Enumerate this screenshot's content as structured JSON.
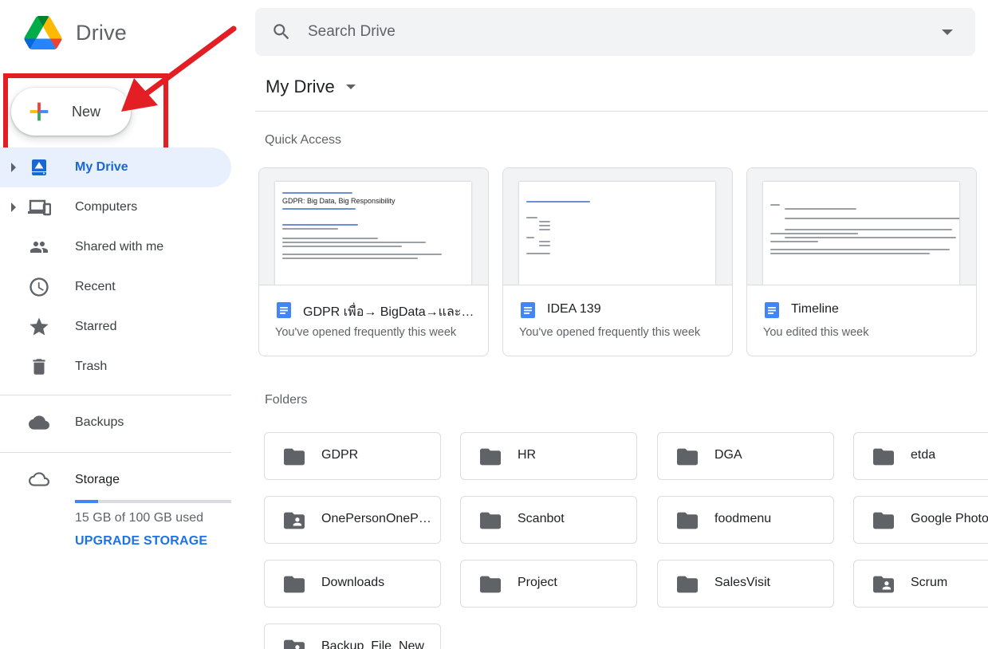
{
  "app": {
    "name": "Drive"
  },
  "sidebar": {
    "new_label": "New",
    "items": [
      {
        "label": "My Drive",
        "icon": "my-drive-icon",
        "active": true,
        "expandable": true
      },
      {
        "label": "Computers",
        "icon": "computers-icon",
        "active": false,
        "expandable": true
      },
      {
        "label": "Shared with me",
        "icon": "shared-with-me-icon",
        "active": false,
        "expandable": false
      },
      {
        "label": "Recent",
        "icon": "clock-icon",
        "active": false,
        "expandable": false
      },
      {
        "label": "Starred",
        "icon": "star-icon",
        "active": false,
        "expandable": false
      },
      {
        "label": "Trash",
        "icon": "trash-icon",
        "active": false,
        "expandable": false
      }
    ],
    "backups_label": "Backups",
    "storage": {
      "label": "Storage",
      "used_text": "15 GB of 100 GB used",
      "used_fraction": 0.15,
      "upgrade_label": "UPGRADE STORAGE"
    }
  },
  "search": {
    "placeholder": "Search Drive"
  },
  "main": {
    "title": "My Drive",
    "quick_access_label": "Quick Access",
    "quick_access": [
      {
        "title": "GDPR เพื่อ→ BigData→และ Digital Transformation",
        "subtitle": "You've opened frequently this week",
        "preview_heading": "GDPR: Big Data, Big Responsibility"
      },
      {
        "title": "IDEA 139",
        "subtitle": "You've opened frequently this week",
        "preview_heading": ""
      },
      {
        "title": "Timeline",
        "subtitle": "You edited this week",
        "preview_heading": ""
      }
    ],
    "folders_label": "Folders",
    "folders": [
      {
        "name": "GDPR",
        "shared": false
      },
      {
        "name": "HR",
        "shared": false
      },
      {
        "name": "DGA",
        "shared": false
      },
      {
        "name": "etda",
        "shared": false
      },
      {
        "name": "OnePersonOnePage",
        "shared": true
      },
      {
        "name": "Scanbot",
        "shared": false
      },
      {
        "name": "foodmenu",
        "shared": false
      },
      {
        "name": "Google Photos",
        "shared": false
      },
      {
        "name": "Downloads",
        "shared": false
      },
      {
        "name": "Project",
        "shared": false
      },
      {
        "name": "SalesVisit",
        "shared": false
      },
      {
        "name": "Scrum",
        "shared": true
      },
      {
        "name": "Backup_File_New",
        "shared": true
      }
    ]
  },
  "colors": {
    "accent_blue": "#1a73e8",
    "active_bg": "#e8f0fe",
    "annotation_red": "#e31e24",
    "folder_grey": "#5f6368"
  }
}
